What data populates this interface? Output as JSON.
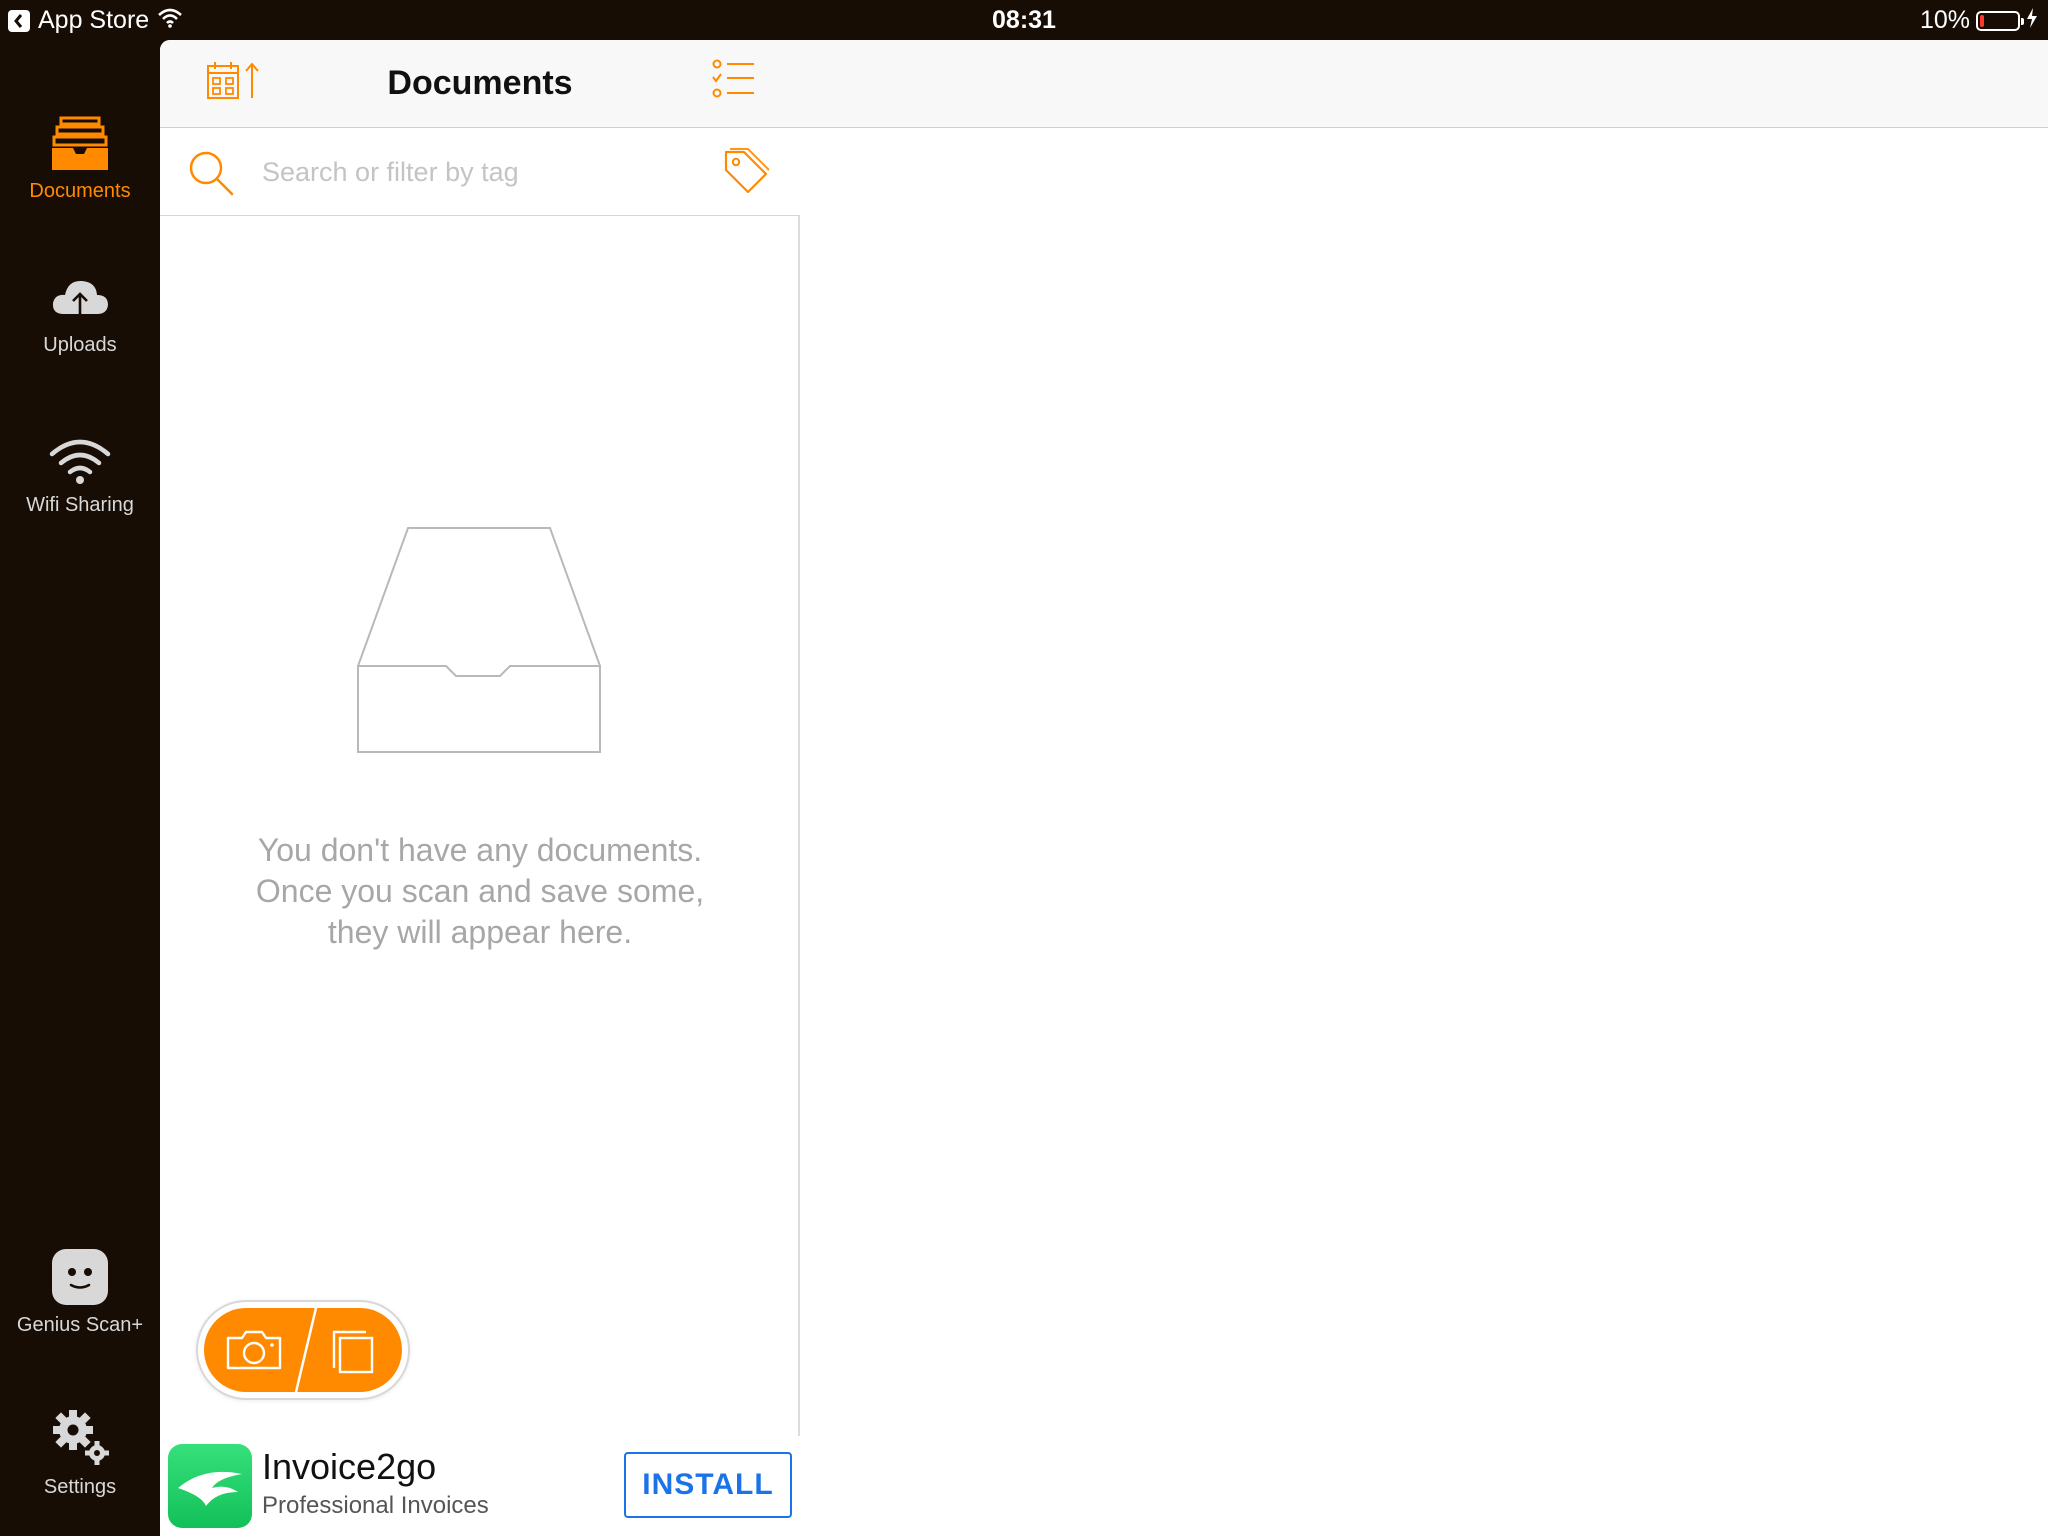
{
  "status_bar": {
    "back_app": "App Store",
    "time": "08:31",
    "battery_percent": "10%",
    "battery_level": 0.1
  },
  "sidebar": {
    "items": [
      {
        "label": "Documents",
        "icon": "inbox-tray-icon",
        "active": true
      },
      {
        "label": "Uploads",
        "icon": "cloud-upload-icon",
        "active": false
      },
      {
        "label": "Wifi Sharing",
        "icon": "wifi-icon",
        "active": false
      },
      {
        "label": "Genius Scan+",
        "icon": "smiley-face-icon",
        "active": false
      },
      {
        "label": "Settings",
        "icon": "gears-icon",
        "active": false
      }
    ]
  },
  "documents_panel": {
    "title": "Documents",
    "sort_button_icon": "calendar-sort-icon",
    "select_button_icon": "checklist-icon",
    "search": {
      "placeholder": "Search or filter by tag",
      "value": ""
    },
    "tag_button_icon": "tag-icon",
    "empty_state": {
      "icon": "empty-tray-icon",
      "lines": [
        "You don't have any documents.",
        "Once you scan and save some,",
        "they will appear here."
      ]
    },
    "scan_button": {
      "camera_icon": "camera-icon",
      "import_icon": "import-pages-icon"
    }
  },
  "ad": {
    "app_name": "Invoice2go",
    "subtitle": "Professional Invoices",
    "install_label": "INSTALL"
  },
  "colors": {
    "accent": "#ff8a00",
    "sidebar_bg": "#180d05",
    "install_blue": "#1a73e8"
  }
}
